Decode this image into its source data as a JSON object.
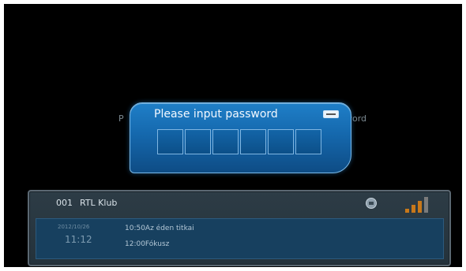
{
  "background_prompt": {
    "left_fragment": "P",
    "right_fragment": "word"
  },
  "password_dialog": {
    "title": "Please input password",
    "box_count": 6,
    "keyboard_icon": "keyboard-icon"
  },
  "channel": {
    "number": "001",
    "name": "RTL Klub",
    "lock_icon": "lock-icon",
    "signal_bars": 4,
    "signal_active_bars": 3,
    "signal_colors": {
      "active": "#c8781a",
      "inactive": "#7b7b7b"
    }
  },
  "epg": {
    "date": "2012/10/26",
    "time": "11:12",
    "programs": [
      "10:50Az éden titkai",
      "12:00Fókusz"
    ]
  },
  "colors": {
    "dialog_accent": "#1568ad",
    "epg_background": "#17405f"
  }
}
